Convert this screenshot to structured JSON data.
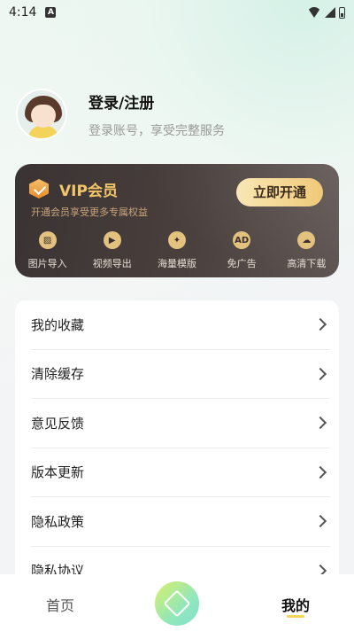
{
  "status": {
    "time": "4:14",
    "notif_icon": "A"
  },
  "profile": {
    "title": "登录/注册",
    "subtitle": "登录账号，享受完整服务"
  },
  "vip": {
    "title": "VIP会员",
    "subtitle": "开通会员享受更多专属权益",
    "button": "立即开通",
    "features": [
      {
        "label": "图片导入",
        "icon": "image-icon"
      },
      {
        "label": "视频导出",
        "icon": "play-icon"
      },
      {
        "label": "海量模版",
        "icon": "magic-wand-icon"
      },
      {
        "label": "免广告",
        "icon": "ad-icon"
      },
      {
        "label": "高清下载",
        "icon": "cloud-download-icon"
      }
    ]
  },
  "menu": {
    "items": [
      {
        "label": "我的收藏"
      },
      {
        "label": "清除缓存"
      },
      {
        "label": "意见反馈"
      },
      {
        "label": "版本更新"
      },
      {
        "label": "隐私政策"
      },
      {
        "label": "隐私协议"
      }
    ]
  },
  "nav": {
    "home": "首页",
    "mine": "我的"
  },
  "colors": {
    "vip_gold": "#f3c56a",
    "accent_yellow": "#f3d35a"
  }
}
